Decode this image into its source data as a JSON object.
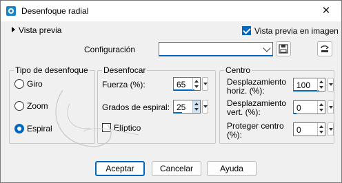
{
  "window": {
    "title": "Desenfoque radial",
    "close_glyph": "✕"
  },
  "preview": {
    "toggle_label": "Vista previa",
    "checkbox_label": "Vista previa en imagen",
    "checked": true
  },
  "config": {
    "label": "Configuración",
    "value": ""
  },
  "blur_type": {
    "title": "Tipo de desenfoque",
    "options": [
      {
        "label": "Giro",
        "selected": false
      },
      {
        "label": "Zoom",
        "selected": false
      },
      {
        "label": "Espiral",
        "selected": true
      }
    ]
  },
  "blur": {
    "title": "Desenfocar",
    "strength_label": "Fuerza (%):",
    "strength_value": "65",
    "spiral_label": "Grados de espiral:",
    "spiral_value": "25",
    "elliptic_label": "Elíptico",
    "elliptic_checked": false
  },
  "center": {
    "title": "Centro",
    "h_label_1": "Desplazamiento",
    "h_label_2": "horiz. (%):",
    "h_value": "100",
    "v_label_1": "Desplazamiento",
    "v_label_2": "vert. (%):",
    "v_value": "0",
    "protect_label_1": "Proteger centro",
    "protect_label_2": "(%):",
    "protect_value": "0"
  },
  "buttons": {
    "accept": "Aceptar",
    "cancel": "Cancelar",
    "help": "Ayuda"
  },
  "colors": {
    "accent": "#0067c0",
    "background": "#f0f0f0"
  }
}
